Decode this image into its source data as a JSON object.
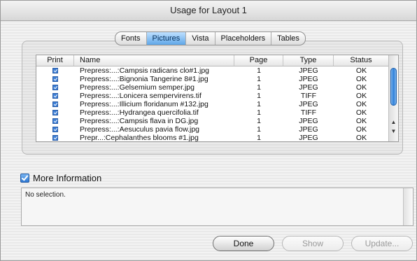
{
  "window": {
    "title": "Usage for Layout 1"
  },
  "tabs": [
    {
      "label": "Fonts",
      "active": false
    },
    {
      "label": "Pictures",
      "active": true
    },
    {
      "label": "Vista",
      "active": false
    },
    {
      "label": "Placeholders",
      "active": false
    },
    {
      "label": "Tables",
      "active": false
    }
  ],
  "table": {
    "columns": {
      "print": "Print",
      "name": "Name",
      "page": "Page",
      "type": "Type",
      "status": "Status"
    },
    "rows": [
      {
        "print": true,
        "name": "Prepress:...:Campsis radicans clo#1.jpg",
        "page": "1",
        "type": "JPEG",
        "status": "OK"
      },
      {
        "print": true,
        "name": "Prepress:...:Bignonia Tangerine 8#1.jpg",
        "page": "1",
        "type": "JPEG",
        "status": "OK"
      },
      {
        "print": true,
        "name": "Prepress:...:Gelsemium semper.jpg",
        "page": "1",
        "type": "JPEG",
        "status": "OK"
      },
      {
        "print": true,
        "name": "Prepress:...:Lonicera sempervirens.tif",
        "page": "1",
        "type": "TIFF",
        "status": "OK"
      },
      {
        "print": true,
        "name": "Prepress:...:Illicium floridanum #132.jpg",
        "page": "1",
        "type": "JPEG",
        "status": "OK"
      },
      {
        "print": true,
        "name": "Prepress:...:Hydrangea quercifolia.tif",
        "page": "1",
        "type": "TIFF",
        "status": "OK"
      },
      {
        "print": true,
        "name": "Prepress:...:Campsis flava in DG.jpg",
        "page": "1",
        "type": "JPEG",
        "status": "OK"
      },
      {
        "print": true,
        "name": "Prepress:...:Aesuculus pavia flow.jpg",
        "page": "1",
        "type": "JPEG",
        "status": "OK"
      },
      {
        "print": true,
        "name": "Prepr...:Cephalanthes blooms #1.jpg",
        "page": "1",
        "type": "JPEG",
        "status": "OK"
      }
    ]
  },
  "more_info": {
    "label": "More Information",
    "checked": true,
    "text": "No selection."
  },
  "buttons": {
    "done": "Done",
    "show": "Show",
    "update": "Update..."
  }
}
